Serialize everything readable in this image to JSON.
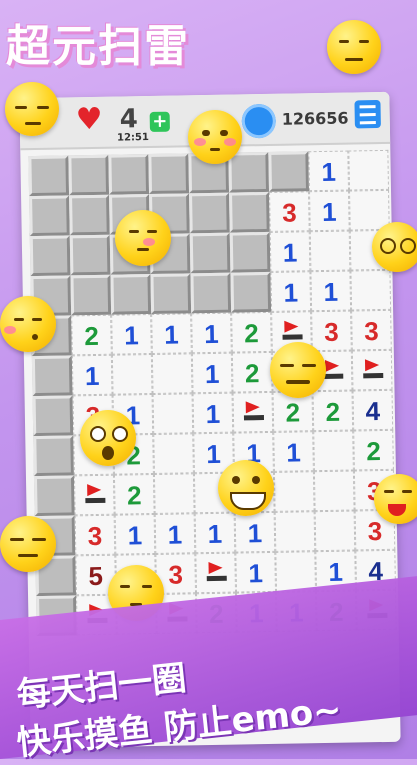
{
  "app": {
    "title": "超元扫雷"
  },
  "topbar": {
    "lives": "4",
    "timer": "12:51",
    "plus_label": "+",
    "score": "126656"
  },
  "colors": {
    "c1": "#1f4fd6",
    "c2": "#1d9a3a",
    "c3": "#d72a2a",
    "c4": "#1a2f8f",
    "c5": "#8b1a1a"
  },
  "board": {
    "rows": [
      [
        "x",
        "x",
        "x",
        "x",
        "x",
        "x",
        "x",
        "1",
        "o"
      ],
      [
        "x",
        "x",
        "x",
        "x",
        "x",
        "x",
        "3",
        "1",
        "o"
      ],
      [
        "x",
        "x",
        "x",
        "x",
        "x",
        "x",
        "1",
        "o",
        "o"
      ],
      [
        "x",
        "x",
        "x",
        "x",
        "x",
        "x",
        "1",
        "1",
        "o"
      ],
      [
        "x",
        "2",
        "1",
        "1",
        "1",
        "2",
        "F",
        "3",
        "3"
      ],
      [
        "x",
        "1",
        "o",
        "o",
        "1",
        "2",
        "F",
        "F",
        "F"
      ],
      [
        "x",
        "3",
        "1",
        "o",
        "1",
        "F",
        "2",
        "2",
        "4"
      ],
      [
        "x",
        "o",
        "2",
        "o",
        "1",
        "1",
        "1",
        "o",
        "2"
      ],
      [
        "x",
        "F",
        "2",
        "o",
        "o",
        "o",
        "o",
        "o",
        "3"
      ],
      [
        "x",
        "3",
        "1",
        "1",
        "1",
        "1",
        "o",
        "o",
        "3"
      ],
      [
        "x",
        "5",
        "3",
        "3",
        "F",
        "1",
        "o",
        "1",
        "4"
      ],
      [
        "x",
        "F",
        "o",
        "F",
        "2",
        "1",
        "1",
        "2",
        "F"
      ]
    ]
  },
  "slogan": {
    "line1": "每天扫一圈",
    "line2": "快乐摸鱼 防止emo~"
  }
}
